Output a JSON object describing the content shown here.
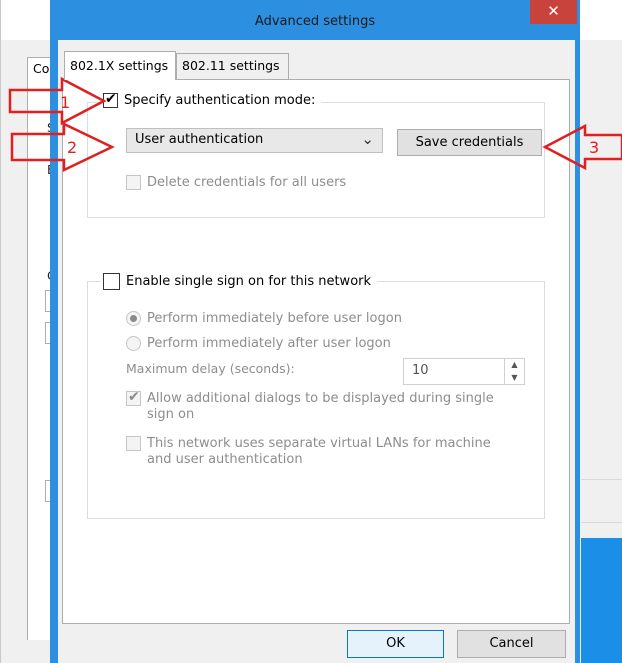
{
  "dialog": {
    "title": "Advanced settings",
    "close_glyph": "✕",
    "tabs": [
      {
        "label": "802.1X settings",
        "active": true
      },
      {
        "label": "802.11 settings",
        "active": false
      }
    ],
    "specify_auth": {
      "label": "Specify authentication mode:",
      "checked": true
    },
    "auth_mode": {
      "selected": "User authentication"
    },
    "save_credentials_label": "Save credentials",
    "delete_credentials": {
      "label": "Delete credentials for all users",
      "checked": false
    },
    "sso": {
      "label": "Enable single sign on for this network",
      "checked": false,
      "option_before": "Perform immediately before user logon",
      "option_after": "Perform immediately after user logon",
      "selected_option": "before",
      "max_delay_label": "Maximum delay (seconds):",
      "max_delay_value": "10",
      "allow_dialogs_label": "Allow additional dialogs to be displayed during single sign on",
      "allow_dialogs_checked": true,
      "vlan_label": "This network uses separate virtual LANs for machine and user authentication",
      "vlan_checked": false
    },
    "ok_label": "OK",
    "cancel_label": "Cancel"
  },
  "background_window": {
    "tab_label": "Co",
    "letters": [
      "S",
      "E",
      "C"
    ]
  },
  "annotations": {
    "labels": [
      "1",
      "2",
      "3"
    ],
    "color": "#e02020"
  },
  "colors": {
    "dialog_frame": "#2c8fe0",
    "close_button": "#c7433b"
  }
}
